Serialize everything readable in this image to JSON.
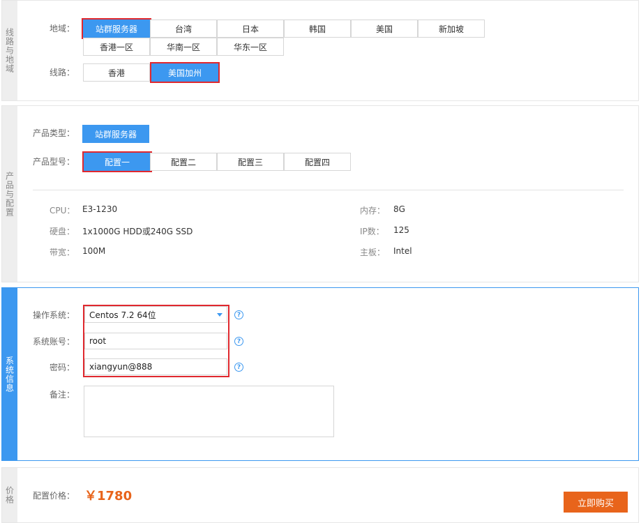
{
  "region_section": {
    "tab": "线路与地域",
    "region_label": "地域：",
    "regions": [
      "站群服务器",
      "台湾",
      "日本",
      "韩国",
      "美国",
      "新加坡",
      "香港一区",
      "华南一区",
      "华东一区"
    ],
    "line_label": "线路：",
    "lines": [
      "香港",
      "美国加州"
    ]
  },
  "product_section": {
    "tab": "产品与配置",
    "type_label": "产品类型：",
    "type_value": "站群服务器",
    "model_label": "产品型号：",
    "models": [
      "配置一",
      "配置二",
      "配置三",
      "配置四"
    ],
    "specs": {
      "cpu_k": "CPU：",
      "cpu_v": "E3-1230",
      "mem_k": "内存：",
      "mem_v": "8G",
      "disk_k": "硬盘：",
      "disk_v": "1x1000G HDD或240G SSD",
      "ip_k": "IP数：",
      "ip_v": "125",
      "bw_k": "带宽：",
      "bw_v": "100M",
      "board_k": "主板：",
      "board_v": "Intel"
    }
  },
  "system_section": {
    "tab": "系统信息",
    "os_label": "操作系统：",
    "os_value": "Centos 7.2 64位",
    "account_label": "系统账号：",
    "account_value": "root",
    "password_label": "密码：",
    "password_value": "xiangyun@888",
    "note_label": "备注：",
    "help_glyph": "?"
  },
  "price_section": {
    "tab": "价格",
    "price_label": "配置价格：",
    "price_value": "￥1780",
    "buy_label": "立即购买"
  },
  "colors": {
    "accent": "#3c98f0",
    "highlight": "#e0282e",
    "buy": "#e8641b",
    "price": "#e8641b"
  }
}
